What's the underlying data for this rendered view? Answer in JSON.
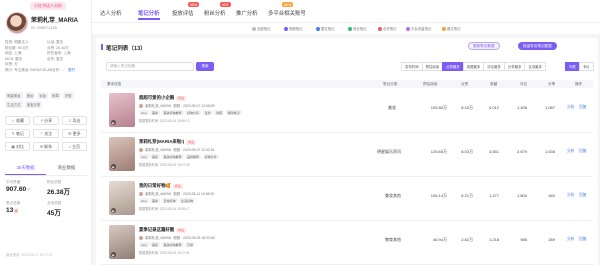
{
  "account": {
    "badge": "小红书达人分析",
    "name": "茉莉札芽_MARIA",
    "id": "ID: 958071185",
    "info_rows": [
      [
        "性别: 明星达人",
        "认证: 暂无"
      ],
      [
        "粉丝数: 90.5万",
        "点赞: 26.38万"
      ],
      [
        "地区: 上海",
        "所在省份: 上海"
      ],
      [
        "MCN: 暂无",
        "合作: 暂无"
      ],
      [
        "标签: 无"
      ],
      [
        "简介: 专注美妆 SARA/CELAB合作: ...",
        "展开"
      ]
    ],
    "tags": [
      "明星美妆",
      "美妆",
      "彩妆",
      "种草",
      "护肤",
      "生活方式",
      "宝宝日常"
    ],
    "actions": [
      {
        "icon": "☆",
        "label": "收藏"
      },
      {
        "icon": "↗",
        "label": "分享"
      },
      {
        "icon": "⇩",
        "label": "导出"
      },
      {
        "icon": "✎",
        "label": "笔记"
      },
      {
        "icon": "♡",
        "label": "关注"
      },
      {
        "icon": "☰",
        "label": "更多"
      },
      {
        "icon": "▣",
        "label": "对比"
      },
      {
        "icon": "✉",
        "label": "联系"
      },
      {
        "icon": "⌂",
        "label": "主页"
      }
    ],
    "tabs": [
      "30天数据",
      "商业数据"
    ],
    "stats": [
      {
        "label": "平均赞藏",
        "value": "907.60",
        "note": "个"
      },
      {
        "label": "粉丝总数",
        "value": "26.38万",
        "note": ""
      },
      {
        "label": "笔记总数",
        "value": "13",
        "note": "篇"
      },
      {
        "label": "互动总数",
        "value": "45万",
        "note": ""
      }
    ],
    "update": "最近更新: 2023-05-17 09:17:47"
  },
  "top_tabs": [
    {
      "label": "达人分析",
      "active": false
    },
    {
      "label": "笔记分析",
      "active": true
    },
    {
      "label": "投放评估",
      "active": false
    },
    {
      "label": "粉丝分析",
      "active": false
    },
    {
      "label": "推广分析",
      "active": false
    },
    {
      "label": "多平台相关账号",
      "active": false
    }
  ],
  "top_badges": [
    "NEW",
    "HOT",
    "NEW"
  ],
  "legend": [
    {
      "label": "全部笔记",
      "color": "#bbbbbb"
    },
    {
      "label": "视频笔记",
      "color": "#7b5cf5"
    },
    {
      "label": "图文笔记",
      "color": "#4a7df0"
    },
    {
      "label": "商业笔记",
      "color": "#2fbf71"
    },
    {
      "label": "合作笔记",
      "color": "#f35b5b"
    },
    {
      "label": "平台流量笔记",
      "color": "#c06cf0"
    },
    {
      "label": "爆文笔记",
      "color": "#f7a23b"
    }
  ],
  "notes_panel": {
    "title": "笔记列表（13）",
    "btn_update": "更新笔记数据",
    "btn_export": "批量导出笔记数据",
    "search_placeholder": "请输入笔记标题",
    "search_btn": "搜索",
    "sorts": [
      "发布时间",
      "预估阅读",
      "点赞最多",
      "收藏最多",
      "评论最多",
      "分享最多",
      "互动最多"
    ],
    "active_sort": 2,
    "views": [
      "列表",
      "卡片"
    ],
    "columns": [
      "基本信息",
      "笔记分类",
      "预估阅读",
      "点赞",
      "收藏",
      "评论",
      "分享",
      "操作"
    ]
  },
  "notes": [
    {
      "title": "超超可爱的小企鹅",
      "badge": "商业",
      "author": "茉莉札芽_MARIA",
      "date": "视频 · 2023-05-07 12:08:59",
      "tags": [
        "vlog",
        "美妆",
        "美妆好物推荐",
        "好物分享",
        "爱护",
        "穿搭",
        "爆款笔记"
      ],
      "update": "数据更新时间: 2023-05-16 19:59:12",
      "category": "美妆",
      "read": "105.80万",
      "likes": "8.43万",
      "collects": "4,012",
      "comments": "1,408",
      "shares": "1,087",
      "op1": "分析",
      "op2": "回复",
      "thumb": "#d9a6b9"
    },
    {
      "title": "茉莉札芽(MARIA来啦!)",
      "badge": "商业",
      "author": "茉莉札芽_MARIA",
      "date": "视频 · 2023-05-07 12:42:51",
      "tags": [
        "vlog",
        "美妆",
        "美妆好物推荐",
        "品牌推荐",
        "好物分享"
      ],
      "update": "数据更新时间: 2023-05-16 19:27:33",
      "category": "明星娱乐资讯",
      "read": "125.65万",
      "likes": "8.03万",
      "collects": "3,551",
      "comments": "2,679",
      "shares": "1,635",
      "op1": "分析",
      "op2": "回复",
      "thumb": "#c8a9a0"
    },
    {
      "title": "我的日常好物🥰",
      "badge": "商业",
      "author": "茉莉札芽_MARIA",
      "date": "视频 · 2023-05-11 16:56:52",
      "tags": [
        "vlog",
        "美妆",
        "日常好物",
        "生活好物"
      ],
      "update": "数据更新时间: 2023-05-16 19:26:17",
      "category": "美妆其他",
      "read": "106.14万",
      "likes": "6.21万",
      "collects": "1,477",
      "comments": "1,804",
      "shares": "462",
      "op1": "分析",
      "op2": "回复",
      "thumb": "#c4b9b0"
    },
    {
      "title": "夏季记录这篇好图",
      "badge": "商业",
      "author": "茉莉札芽_MARIA",
      "date": "视频 · 2023-05-08 18:03:06",
      "tags": [
        "vlog",
        "美妆",
        "美妆好物推荐",
        "日常"
      ],
      "update": "数据更新时间: 2023-05-16 19:17:51",
      "category": "教育其他",
      "read": "46.94万",
      "likes": "2.82万",
      "collects": "1,218",
      "comments": "985",
      "shares": "269",
      "op1": "分析",
      "op2": "回复",
      "thumb": "#b7aaa2"
    }
  ]
}
